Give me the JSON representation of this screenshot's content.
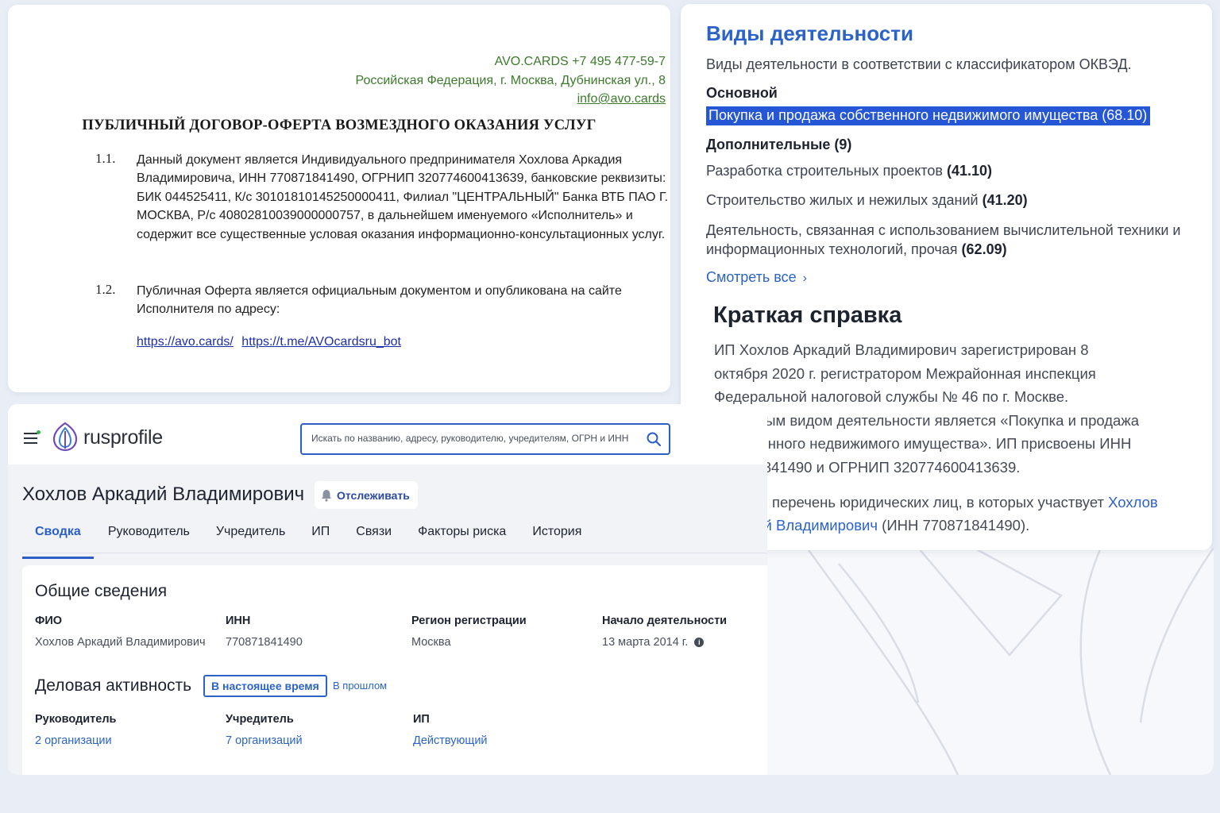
{
  "document": {
    "header_line1": "AVO.CARDS +7 495 477-59-7",
    "header_line2": "Российская Федерация, г. Москва, Дубнинская ул., 8",
    "header_email": "info@avo.cards",
    "title": "ПУБЛИЧНЫЙ ДОГОВОР-ОФЕРТА ВОЗМЕЗДНОГО ОКАЗАНИЯ УСЛУГ",
    "clauses": [
      {
        "num": "1.1.",
        "text": "Данный документ является Индивидуального предпринимателя Хохлова Аркадия Владимировича, ИНН 770871841490, ОГРНИП 320774600413639, банковские реквизиты: БИК 044525411, К/с 30101810145250000411, Филиал \"ЦЕНТРАЛЬНЫЙ\" Банка ВТБ ПАО Г. МОСКВА, Р/с 40802810039000000757, в дальнейшем именуемого «Исполнитель» и содержит все существенные условая оказания информационно-консультационных услуг."
      },
      {
        "num": "1.2.",
        "text": "Публичная Оферта является официальным документом и опубликована на сайте Исполнителя по адресу:"
      }
    ],
    "links": [
      "https://avo.cards/",
      "https://t.me/AVOcardsru_bot"
    ]
  },
  "okved": {
    "title": "Виды деятельности",
    "subtitle": "Виды деятельности в соответствии с классификатором ОКВЭД.",
    "main_label": "Основной",
    "main_activity": "Покупка и продажа собственного недвижимого имущества (68.10)",
    "extra_label": "Дополнительные (9)",
    "extra": [
      {
        "name": "Разработка строительных проектов",
        "code": "(41.10)"
      },
      {
        "name": "Строительство жилых и нежилых зданий",
        "code": "(41.20)"
      },
      {
        "name": "Деятельность, связанная с использованием вычислительной техники и информационных технологий, прочая",
        "code": "(62.09)"
      }
    ],
    "see_all": "Смотреть все"
  },
  "summary": {
    "title": "Краткая справка",
    "text": "ИП Хохлов Аркадий Владимирович зарегистрирован 8 октября 2020 г. регистратором Межрайонная инспекция Федеральной налоговой службы № 46 по г. Москве. Основным видом деятельности является «Покупка и продажа собственного недвижимого имущества». ИП присвоены ИНН 770871841490 и ОГРНИП 320774600413639.",
    "text2_prefix": "Полный перечень юридических лиц, в которых участвует",
    "text2_link": "Хохлов Аркадий Владимирович",
    "text2_suffix": "(ИНН 770871841490)."
  },
  "rusprofile": {
    "logo": "rusprofile",
    "search_placeholder": "Искать по названию, адресу, руководителю, учредителям, ОГРН и ИНН",
    "person_name": "Хохлов Аркадий Владимирович",
    "track_label": "Отслеживать",
    "tabs": [
      "Сводка",
      "Руководитель",
      "Учредитель",
      "ИП",
      "Связи",
      "Факторы риска",
      "История"
    ],
    "general": {
      "title": "Общие сведения",
      "fio_label": "ФИО",
      "fio_value": "Хохлов Аркадий Владимирович",
      "inn_label": "ИНН",
      "inn_value": "770871841490",
      "region_label": "Регион регистрации",
      "region_value": "Москва",
      "start_label": "Начало деятельности",
      "start_value": "13 марта 2014 г."
    },
    "business": {
      "title": "Деловая активность",
      "seg_active": "В настоящее время",
      "seg_other": "В прошлом",
      "manager_label": "Руководитель",
      "manager_value": "2 организации",
      "founder_label": "Учредитель",
      "founder_value": "7 организаций",
      "ip_label": "ИП",
      "ip_value": "Действующий"
    }
  },
  "colors": {
    "accent": "#2c63c6",
    "highlight": "#2456d6",
    "doc_green": "#3c7a2c",
    "background": "#e9eef6"
  }
}
